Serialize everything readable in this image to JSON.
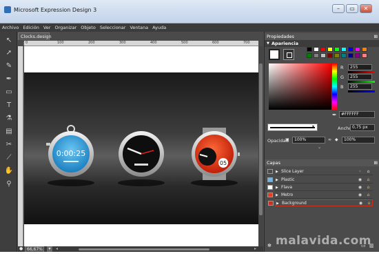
{
  "window": {
    "title": "Microsoft Expression Design 3",
    "minimize": "–",
    "maximize": "▭",
    "close": "✕"
  },
  "menu": [
    "Archivo",
    "Edición",
    "Ver",
    "Organizar",
    "Objeto",
    "Seleccionar",
    "Ventana",
    "Ayuda"
  ],
  "document": {
    "tab": "Clocks.design",
    "tab_close": "×",
    "zoom": "66,67%",
    "ruler_ticks": [
      "0",
      "100",
      "200",
      "300",
      "400",
      "500",
      "600",
      "700"
    ],
    "clocks": {
      "timer_text": "0:00:25",
      "metro_number": "05"
    }
  },
  "properties": {
    "title": "Propiedades",
    "appearance": "Apariencia",
    "rgb": [
      {
        "label": "R",
        "value": "255",
        "color": "#ff0000"
      },
      {
        "label": "G",
        "value": "255",
        "color": "#00ff00"
      },
      {
        "label": "B",
        "value": "255",
        "color": "#0000ff"
      }
    ],
    "hex": "#FFFFFF",
    "width_label": "Ancho",
    "width_value": "0,75 px",
    "opacity_label": "Opacidad",
    "opacity_value": "100%",
    "opacity_value_2": "100%",
    "swatch_colors": [
      "#000000",
      "#ffffff",
      "#ff0000",
      "#ffff00",
      "#00ff00",
      "#00ffff",
      "#0000ff",
      "#ff00ff",
      "#ff8000",
      "#008000",
      "#808080",
      "#c0c0c0",
      "#800000",
      "#808000",
      "#008080",
      "#000080",
      "#800080",
      "#ff8080"
    ]
  },
  "layers": {
    "title": "Capas",
    "items": [
      {
        "name": "Slice Layer",
        "color": "#4a4a4a"
      },
      {
        "name": "Plastic",
        "color": "#6db6e8"
      },
      {
        "name": "Flava",
        "color": "#ffffff"
      },
      {
        "name": "Metro",
        "color": "#e04020"
      },
      {
        "name": "Background",
        "color": "#c83020"
      }
    ]
  },
  "watermark": "malavida.com"
}
